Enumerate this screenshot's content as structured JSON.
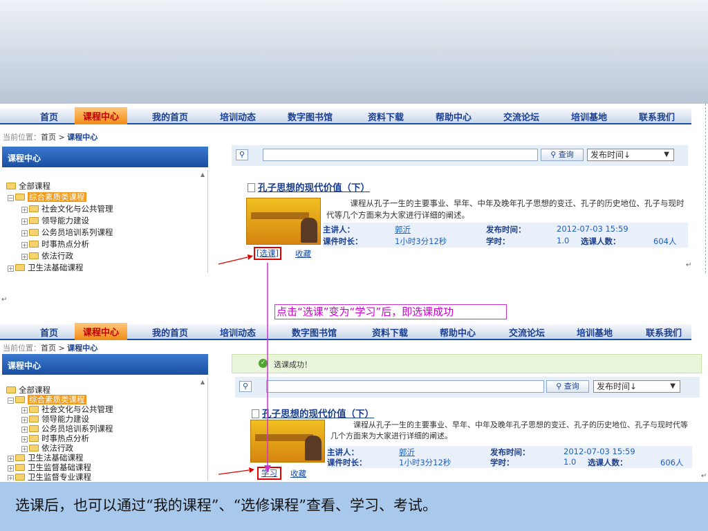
{
  "nav_items": [
    "首页",
    "课程中心",
    "我的首页",
    "培训动态",
    "数字图书馆",
    "资料下载",
    "帮助中心",
    "交流论坛",
    "培训基地",
    "联系我们"
  ],
  "nav_active": "课程中心",
  "breadcrumb": {
    "label": "当前位置：",
    "home": "首页",
    "sep": ">",
    "current": "课程中心"
  },
  "sidebar_title": "课程中心",
  "tree1": [
    "全部课程",
    "综合素质类课程",
    "社会文化与公共管理",
    "领导能力建设",
    "公务员培训系列课程",
    "时事热点分析",
    "依法行政",
    "卫生法基础课程"
  ],
  "tree2": [
    "全部课程",
    "综合素质类课程",
    "社会文化与公共管理",
    "领导能力建设",
    "公务员培训系列课程",
    "时事热点分析",
    "依法行政",
    "卫生法基础课程",
    "卫生监督基础课程",
    "卫生监督专业课程"
  ],
  "search": {
    "button": "查询",
    "sort": "发布时间↓"
  },
  "course": {
    "title": "孔子思想的现代价值（下）",
    "desc": "课程从孔子一生的主要事业、早年、中年及晚年孔子思想的变迁、孔子的历史地位、孔子与现时代等几个方面来为大家进行详细的阐述。",
    "lecturer_label": "主讲人：",
    "lecturer": "郭沂",
    "pub_label": "发布时间：",
    "pub": "2012-07-03 15:59",
    "duration_label": "课件时长：",
    "duration": "1小时3分12秒",
    "hours_label": "学时：",
    "hours": "1.0",
    "count_label": "选课人数：",
    "count_before": "604人",
    "count_after": "606人",
    "fav": "收藏"
  },
  "select_btn_before": "[选课]",
  "select_btn_after": "学习",
  "success_msg": "选课成功！",
  "annotation": "点击“选课”变为“学习”后，即选课成功",
  "caption": "选课后，也可以通过“我的课程”、“选修课程”查看、学习、考试。",
  "colors": {
    "nav_active": "#f08a15",
    "nav_text": "#1b3f8f",
    "header_blue": "#1a4fa0",
    "highlight": "#e00000",
    "annot": "#d000d0",
    "caption_bg": "#a9c9ec"
  }
}
